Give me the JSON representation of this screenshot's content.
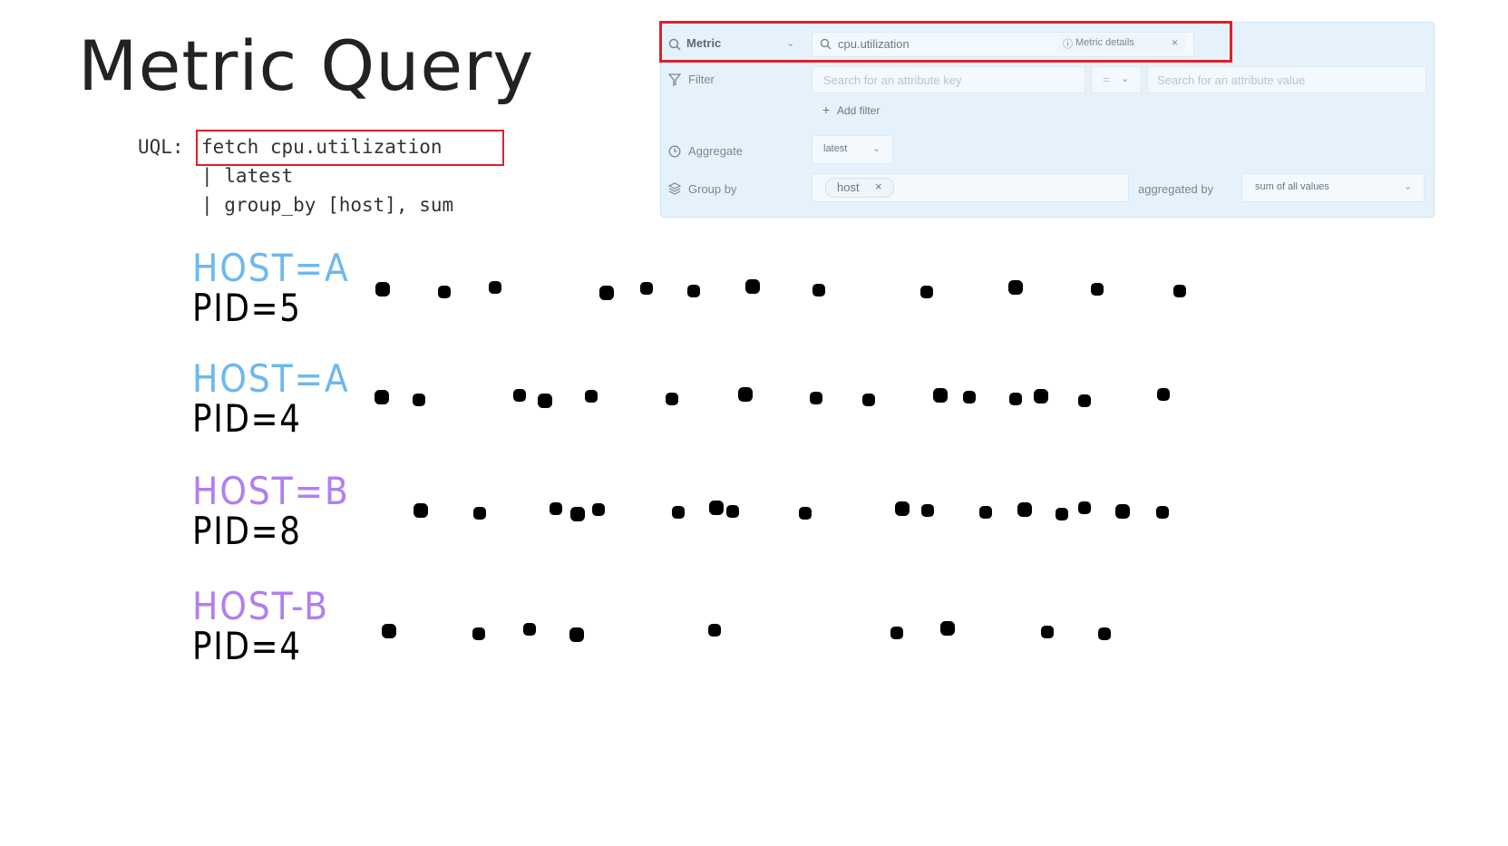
{
  "title": "Metric Query",
  "uql": {
    "prefix": "UQL:",
    "lines": [
      "fetch cpu.utilization",
      "| latest",
      "| group_by [host], sum"
    ]
  },
  "query_builder": {
    "metric": {
      "label": "Metric",
      "value": "cpu.utilization",
      "details": "Metric details"
    },
    "filter": {
      "label": "Filter",
      "key_placeholder": "Search for an attribute key",
      "operator": "=",
      "value_placeholder": "Search for an attribute value",
      "add_filter": "Add filter"
    },
    "aggregate": {
      "label": "Aggregate",
      "value": "latest"
    },
    "group_by": {
      "label": "Group by",
      "tag": "host",
      "aggregated_by_label": "aggregated by",
      "aggregated_by_value": "sum of all values"
    }
  },
  "series": [
    {
      "host": "HOST=A",
      "pid": "PID=5",
      "color": "#6db8f0",
      "points": [
        422,
        490,
        546,
        669,
        713,
        765,
        830,
        903,
        1022,
        1120,
        1210,
        1301
      ]
    },
    {
      "host": "HOST=A",
      "pid": "PID=4",
      "color": "#6db8f0",
      "points": [
        421,
        462,
        573,
        601,
        652,
        741,
        822,
        900,
        958,
        1037,
        1069,
        1120,
        1148,
        1196,
        1283
      ]
    },
    {
      "host": "HOST=B",
      "pid": "PID=8",
      "color": "#b07ff0",
      "points": [
        464,
        529,
        613,
        637,
        660,
        748,
        790,
        808,
        888,
        995,
        1023,
        1087,
        1130,
        1171,
        1196,
        1238,
        1282
      ]
    },
    {
      "host": "HOST-B",
      "pid": "PID=4",
      "color": "#b07ff0",
      "points": [
        429,
        528,
        584,
        636,
        788,
        989,
        1045,
        1155,
        1218
      ]
    }
  ],
  "colors": {
    "highlight": "#e0202a",
    "panel_bg": "#e6f2fb",
    "dot": "#000000"
  }
}
